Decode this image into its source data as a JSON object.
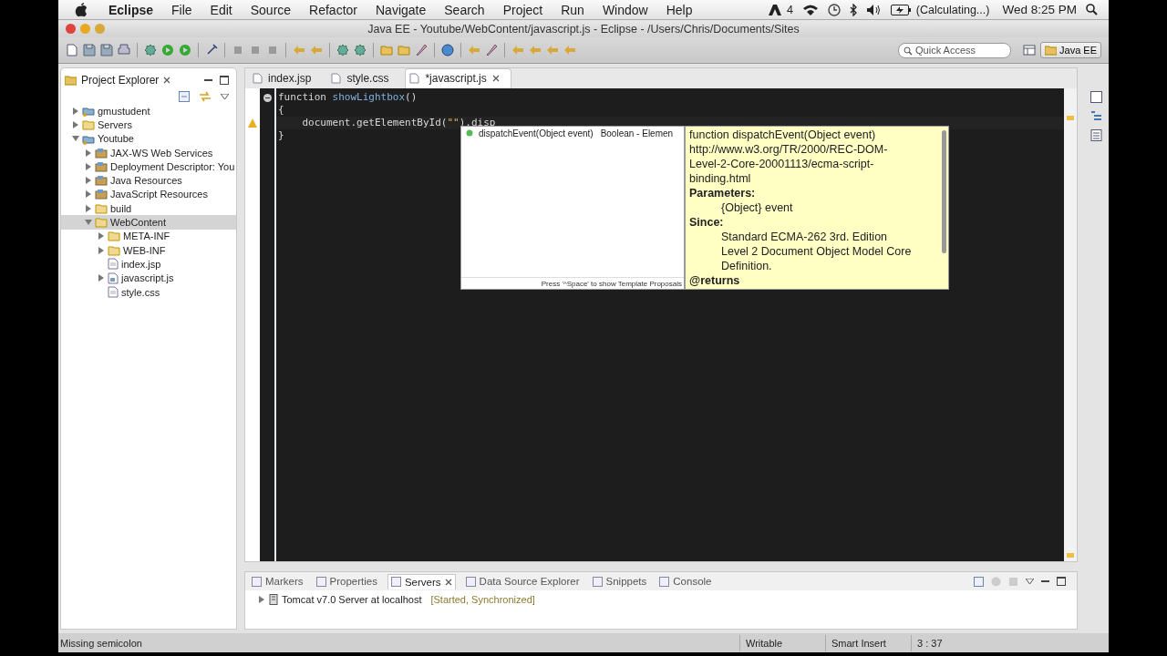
{
  "menubar": {
    "app": "Eclipse",
    "menus": [
      "File",
      "Edit",
      "Source",
      "Refactor",
      "Navigate",
      "Search",
      "Project",
      "Run",
      "Window",
      "Help"
    ],
    "status": {
      "adobe_count": "4",
      "battery": "(Calculating...)",
      "clock": "Wed 8:25 PM"
    }
  },
  "window": {
    "title": "Java EE - Youtube/WebContent/javascript.js - Eclipse - /Users/Chris/Documents/Sites"
  },
  "toolbar": {
    "quick_access": {
      "placeholder": "Quick Access"
    },
    "perspective": "Java EE"
  },
  "project_explorer": {
    "title": "Project Explorer",
    "items": [
      {
        "label": "gmustudent",
        "kind": "project",
        "expanded": false,
        "selected": false
      },
      {
        "label": "Servers",
        "kind": "folder",
        "expanded": false,
        "selected": false
      },
      {
        "label": "Youtube",
        "kind": "project",
        "expanded": true,
        "selected": false,
        "children": [
          {
            "label": "JAX-WS Web Services",
            "kind": "resource",
            "expanded": false,
            "selected": false
          },
          {
            "label": "Deployment Descriptor: You",
            "kind": "resource",
            "expanded": false,
            "selected": false
          },
          {
            "label": "Java Resources",
            "kind": "resource",
            "expanded": false,
            "selected": false
          },
          {
            "label": "JavaScript Resources",
            "kind": "resource",
            "expanded": false,
            "selected": false
          },
          {
            "label": "build",
            "kind": "folder",
            "expanded": false,
            "selected": false
          },
          {
            "label": "WebContent",
            "kind": "folder",
            "expanded": true,
            "selected": true,
            "children": [
              {
                "label": "META-INF",
                "kind": "folder",
                "expanded": false,
                "selected": false
              },
              {
                "label": "WEB-INF",
                "kind": "folder",
                "expanded": false,
                "selected": false
              },
              {
                "label": "index.jsp",
                "kind": "file",
                "selected": false
              },
              {
                "label": "javascript.js",
                "kind": "jsfile",
                "expanded": false,
                "selected": false
              },
              {
                "label": "style.css",
                "kind": "file",
                "selected": false
              }
            ]
          }
        ]
      }
    ]
  },
  "editor": {
    "tabs": [
      {
        "label": "index.jsp",
        "selected": false
      },
      {
        "label": "style.css",
        "selected": false
      },
      {
        "label": "*javascript.js",
        "selected": true
      }
    ],
    "lines": [
      {
        "fold": true,
        "warning": false,
        "tokens": [
          {
            "text": "function",
            "kind": "keyword"
          },
          {
            "text": "showLightbox",
            "kind": "name"
          },
          {
            "text": "()",
            "kind": "plain"
          }
        ]
      },
      {
        "fold": false,
        "warning": false,
        "tokens": [
          {
            "text": "{",
            "kind": "plain"
          }
        ]
      },
      {
        "fold": false,
        "warning": true,
        "tokens": [
          {
            "text": "    document.getElementById(",
            "kind": "plain"
          },
          {
            "text": "\"\"",
            "kind": "string"
          },
          {
            "text": ").disp",
            "kind": "plain"
          }
        ]
      },
      {
        "fold": false,
        "warning": false,
        "tokens": [
          {
            "text": "}",
            "kind": "plain"
          }
        ]
      }
    ],
    "completion": {
      "items": [
        {
          "name": "dispatchEvent(Object event)",
          "type": "Boolean - Elemen"
        }
      ],
      "footer": "Press '^Space' to show Template Proposals"
    },
    "doc": [
      {
        "kind": "text",
        "text": "function dispatchEvent(Object event)"
      },
      {
        "kind": "text",
        "text": "http://www.w3.org/TR/2000/REC-DOM-"
      },
      {
        "kind": "text",
        "text": "Level-2-Core-20001113/ecma-script-"
      },
      {
        "kind": "text",
        "text": "binding.html"
      },
      {
        "kind": "heading",
        "text": "Parameters:"
      },
      {
        "kind": "indent",
        "text": "{Object} event"
      },
      {
        "kind": "heading",
        "text": "Since:"
      },
      {
        "kind": "indent",
        "text": "Standard ECMA-262 3rd. Edition"
      },
      {
        "kind": "indent",
        "text": "Level 2 Document Object Model Core"
      },
      {
        "kind": "indent",
        "text": "Definition."
      },
      {
        "kind": "heading",
        "text": "@returns"
      }
    ]
  },
  "bottom_panel": {
    "tabs": [
      {
        "label": "Markers",
        "selected": false
      },
      {
        "label": "Properties",
        "selected": false
      },
      {
        "label": "Servers",
        "selected": true
      },
      {
        "label": "Data Source Explorer",
        "selected": false
      },
      {
        "label": "Snippets",
        "selected": false
      },
      {
        "label": "Console",
        "selected": false
      }
    ],
    "servers": [
      {
        "name": "Tomcat v7.0 Server at localhost",
        "state": "[Started, Synchronized]",
        "expanded": false
      }
    ]
  },
  "status_bar": {
    "message": "Missing semicolon",
    "mode": "Writable",
    "insert": "Smart Insert",
    "position": "3 : 37"
  }
}
